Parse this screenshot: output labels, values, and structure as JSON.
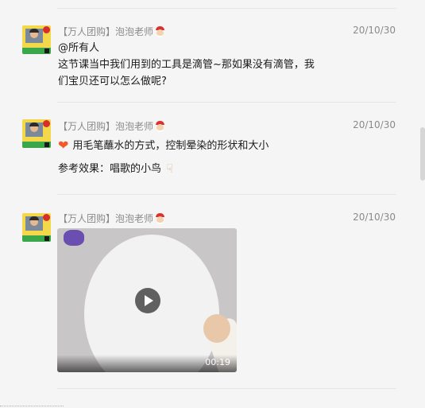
{
  "messages": [
    {
      "sender": "【万人团购】泡泡老师",
      "time": "20/10/30",
      "lines": [
        "@所有人",
        "这节课当中我们用到的工具是滴管~那如果没有滴管，我",
        "们宝贝还可以怎么做呢?"
      ]
    },
    {
      "sender": "【万人团购】泡泡老师",
      "time": "20/10/30",
      "lines": [
        "用毛笔蘸水的方式，控制晕染的形状和大小",
        "参考效果：唱歌的小鸟"
      ],
      "icons": [
        "heart-icon",
        "pointing-down-hand-icon"
      ]
    },
    {
      "sender": "【万人团购】泡泡老师",
      "time": "20/10/30",
      "video": {
        "duration": "00:19"
      }
    }
  ]
}
